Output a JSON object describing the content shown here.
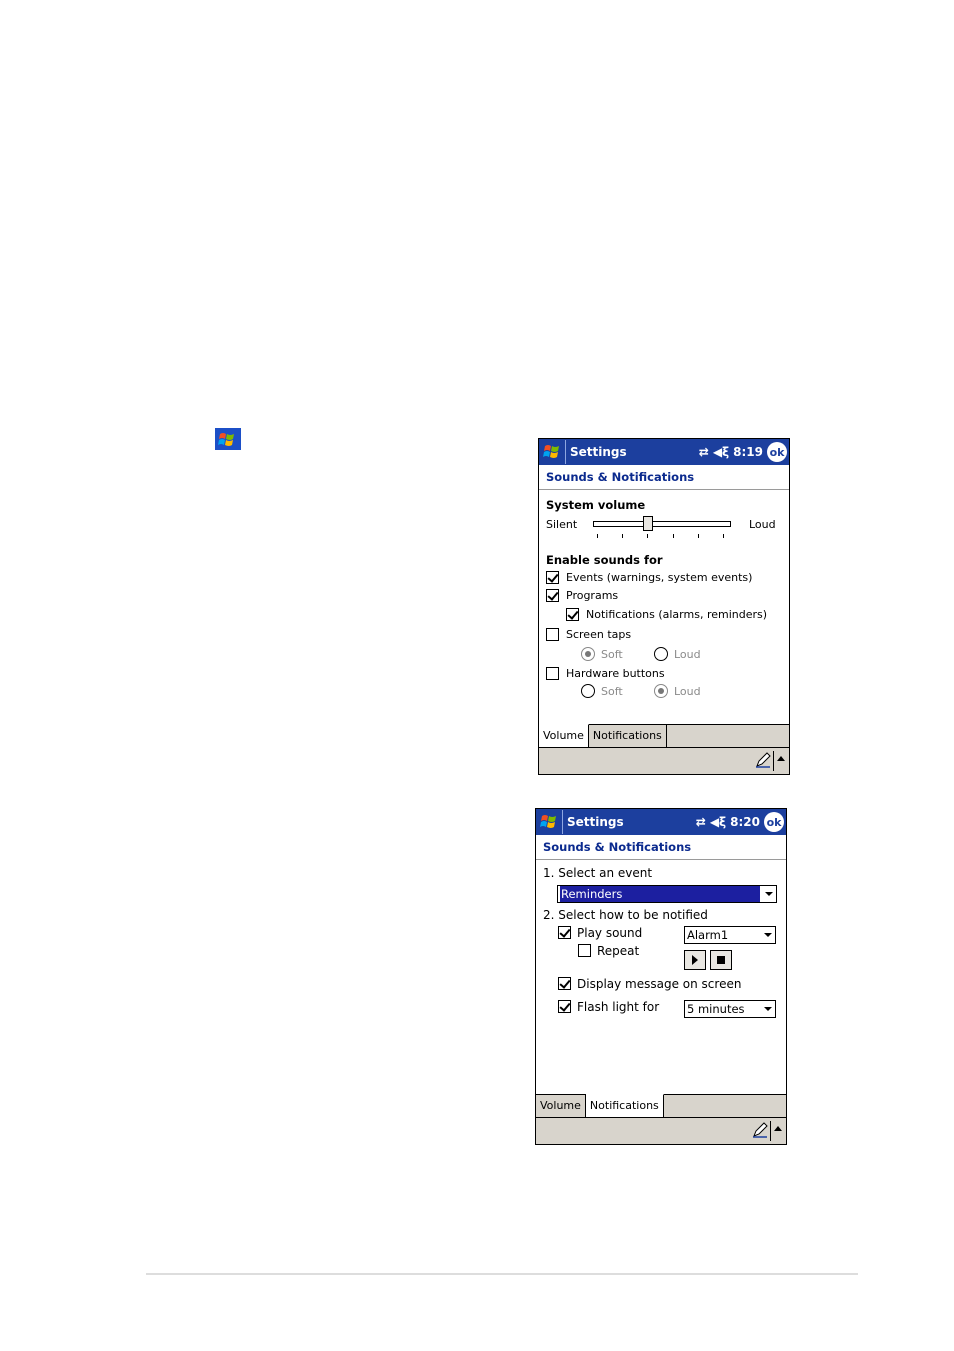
{
  "screen1": {
    "title": "Settings",
    "time": "8:19",
    "ok_label": "ok",
    "subtitle": "Sounds & Notifications",
    "system_volume_label": "System volume",
    "silent_label": "Silent",
    "loud_label": "Loud",
    "volume_level": 0.4,
    "enable_sounds_label": "Enable sounds for",
    "events_label": "Events (warnings, system events)",
    "programs_label": "Programs",
    "notifications_label": "Notifications (alarms, reminders)",
    "screen_taps_label": "Screen taps",
    "hardware_buttons_label": "Hardware buttons",
    "soft_label": "Soft",
    "loud_option_label": "Loud",
    "tabs": [
      "Volume",
      "Notifications"
    ],
    "active_tab": "Volume"
  },
  "screen2": {
    "title": "Settings",
    "time": "8:20",
    "ok_label": "ok",
    "subtitle": "Sounds & Notifications",
    "step1_label": "1. Select an event",
    "event_value": "Reminders",
    "step2_label": "2. Select how to be notified",
    "play_sound_label": "Play sound",
    "sound_value": "Alarm1",
    "repeat_label": "Repeat",
    "display_message_label": "Display message on screen",
    "flash_light_label": "Flash light for",
    "flash_value": "5 minutes",
    "tabs": [
      "Volume",
      "Notifications"
    ],
    "active_tab": "Notifications"
  },
  "colors": {
    "titlebar": "#1c3f9e",
    "subtitle_text": "#0b2a8e",
    "selection": "#1c1fa0",
    "menubar": "#d8d4cc"
  }
}
